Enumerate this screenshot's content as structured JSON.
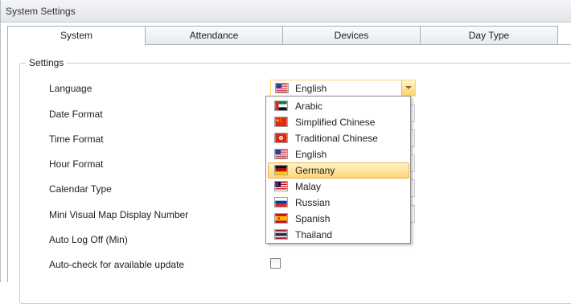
{
  "window": {
    "title": "System Settings"
  },
  "tabs": [
    {
      "label": "System",
      "active": true
    },
    {
      "label": "Attendance",
      "active": false
    },
    {
      "label": "Devices",
      "active": false
    },
    {
      "label": "Day Type",
      "active": false
    }
  ],
  "settings": {
    "group_title": "Settings",
    "labels": {
      "language": "Language",
      "date_format": "Date Format",
      "time_format": "Time Format",
      "hour_format": "Hour Format",
      "calendar_type": "Calendar Type",
      "mini_map": "Mini Visual Map Display Number",
      "auto_logoff": "Auto Log Off (Min)",
      "auto_update": "Auto-check for available update"
    },
    "language_combo": {
      "selected": "English",
      "selected_flag": "us-flag-icon",
      "open": true
    },
    "auto_update_checked": false
  },
  "language_options": [
    {
      "label": "Arabic",
      "flag": "uae-flag-icon"
    },
    {
      "label": "Simplified Chinese",
      "flag": "china-flag-icon"
    },
    {
      "label": "Traditional Chinese",
      "flag": "hong-kong-flag-icon"
    },
    {
      "label": "English",
      "flag": "us-flag-icon"
    },
    {
      "label": "Germany",
      "flag": "germany-flag-icon",
      "highlighted": true
    },
    {
      "label": "Malay",
      "flag": "malaysia-flag-icon"
    },
    {
      "label": "Russian",
      "flag": "russia-flag-icon"
    },
    {
      "label": "Spanish",
      "flag": "spain-flag-icon"
    },
    {
      "label": "Thailand",
      "flag": "thailand-flag-icon"
    }
  ],
  "colors": {
    "accent_highlight": "#ffd57a",
    "combo_border": "#ffd36b",
    "tab_border": "#a9afb8"
  }
}
